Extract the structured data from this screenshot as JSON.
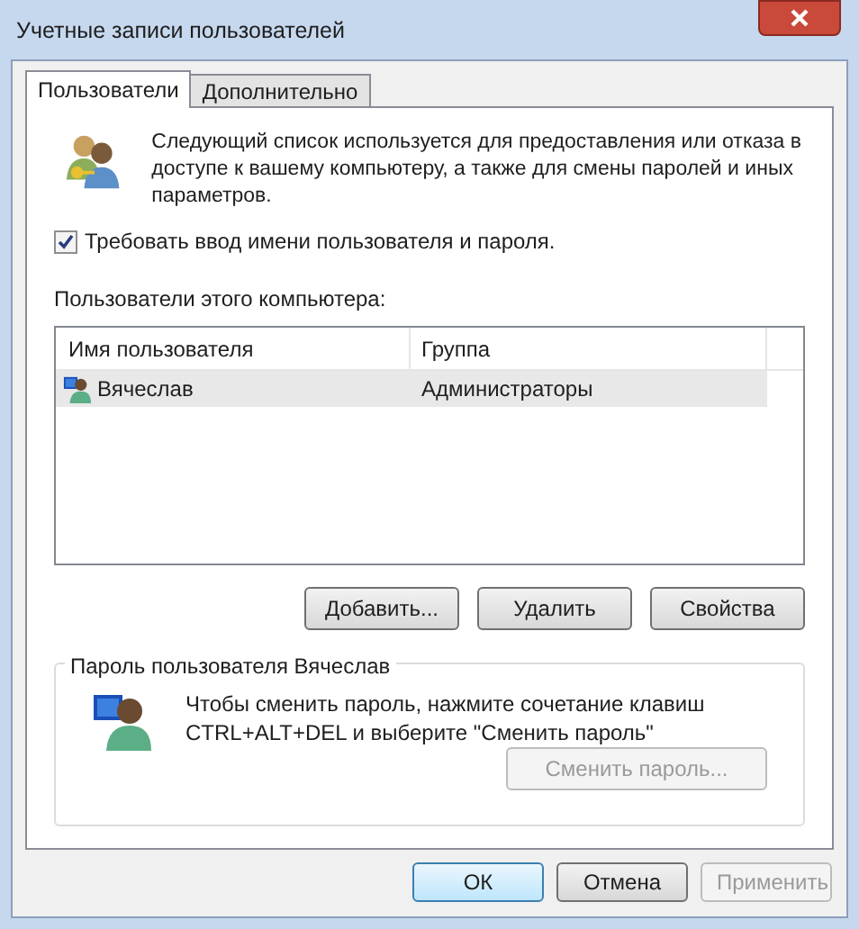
{
  "window": {
    "title": "Учетные записи пользователей"
  },
  "tabs": [
    {
      "label": "Пользователи",
      "selected": true
    },
    {
      "label": "Дополнительно",
      "selected": false
    }
  ],
  "intro": "Следующий список используется для предоставления или отказа в доступе к вашему компьютеру, а также для смены паролей и иных параметров.",
  "require_login": {
    "label": "Требовать ввод имени пользователя и пароля.",
    "checked": true
  },
  "users_label": "Пользователи этого компьютера:",
  "table": {
    "columns": [
      "Имя пользователя",
      "Группа"
    ],
    "rows": [
      {
        "name": "Вячеслав",
        "group": "Администраторы",
        "selected": true
      }
    ]
  },
  "user_buttons": [
    {
      "label": "Добавить..."
    },
    {
      "label": "Удалить"
    },
    {
      "label": "Свойства"
    }
  ],
  "password": {
    "title": "Пароль пользователя Вячеслав",
    "text": "Чтобы сменить пароль, нажмите сочетание клавиш CTRL+ALT+DEL и выберите \"Сменить пароль\"",
    "button": {
      "label": "Сменить пароль...",
      "disabled": true
    }
  },
  "dialog_buttons": [
    {
      "label": "ОК",
      "default": true,
      "disabled": false
    },
    {
      "label": "Отмена",
      "default": false,
      "disabled": false
    },
    {
      "label": "Применить",
      "default": false,
      "disabled": true
    }
  ]
}
